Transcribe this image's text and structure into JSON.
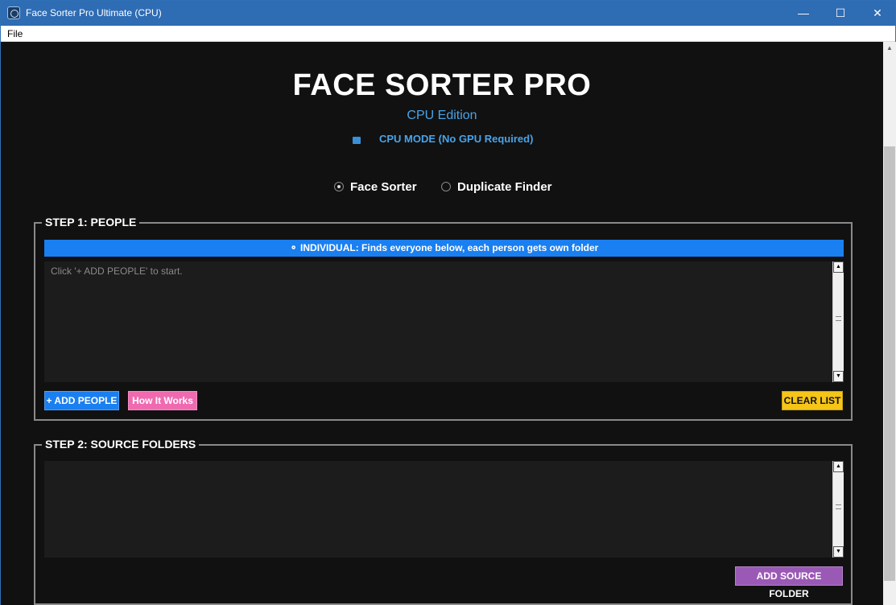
{
  "window": {
    "title": "Face Sorter Pro Ultimate (CPU)"
  },
  "menu": {
    "file": "File"
  },
  "header": {
    "title": "FACE SORTER PRO",
    "edition": "CPU Edition",
    "mode": "CPU MODE (No GPU Required)",
    "mode_icon": "cpu-chip-icon"
  },
  "mode_select": {
    "options": [
      "Face Sorter",
      "Duplicate Finder"
    ],
    "selected": "Face Sorter"
  },
  "step1": {
    "title": "STEP 1: PEOPLE",
    "banner": "⚬ INDIVIDUAL: Finds everyone below, each person gets own folder",
    "placeholder": "Click '+ ADD PEOPLE' to start.",
    "buttons": {
      "add": "+ ADD PEOPLE",
      "how": "How It Works",
      "clear": "CLEAR LIST"
    }
  },
  "step2": {
    "title": "STEP 2: SOURCE FOLDERS",
    "buttons": {
      "add_source": "ADD SOURCE FOLDER"
    }
  },
  "colors": {
    "accent_blue": "#1a7ff0",
    "pink": "#f06ab0",
    "yellow": "#f5c518",
    "purple": "#9b59b6",
    "edition_blue": "#4aa3e8"
  }
}
